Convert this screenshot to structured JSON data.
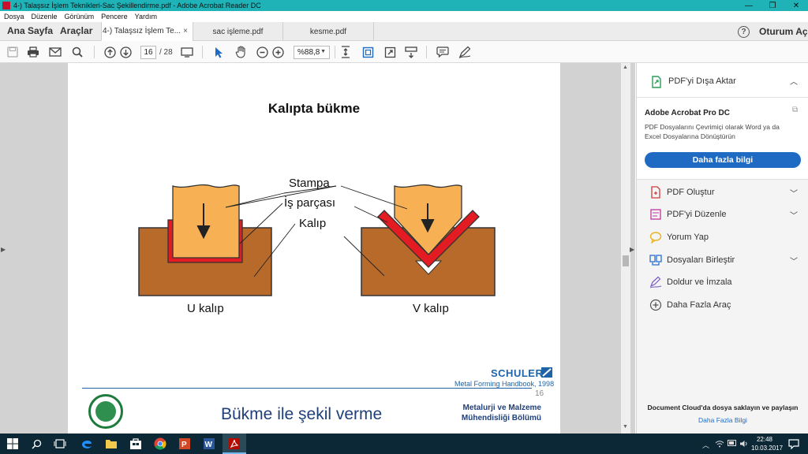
{
  "window": {
    "title": "4-) Talaşsız İşlem Teknikleri-Sac Şekillendirme.pdf - Adobe Acrobat Reader DC",
    "minimize": "—",
    "maximize": "❐",
    "close": "✕"
  },
  "menu": [
    "Dosya",
    "Düzenle",
    "Görünüm",
    "Pencere",
    "Yardım"
  ],
  "tabs": {
    "home": "Ana Sayfa",
    "tools": "Araçlar",
    "documents": [
      {
        "label": "4-) Talaşsız İşlem Te...",
        "active": true,
        "close": "×"
      },
      {
        "label": "sac işleme.pdf",
        "active": false
      },
      {
        "label": "kesme.pdf",
        "active": false
      }
    ],
    "help": "?",
    "signin": "Oturum Aç"
  },
  "toolbar": {
    "current_page": "16",
    "total_pages": "/ 28",
    "zoom": "%88,8",
    "icons": [
      "save-icon",
      "print-icon",
      "email-icon",
      "search-icon",
      "page-up-icon",
      "page-down-icon",
      "page-display-icon",
      "select-cursor-icon",
      "hand-icon",
      "zoom-out-icon",
      "zoom-in-icon",
      "fit-page-icon",
      "crop-icon",
      "fullscreen-icon",
      "scroll-mode-icon",
      "comment-icon",
      "draw-icon"
    ]
  },
  "page": {
    "heading": "Kalıpta bükme",
    "labels": {
      "punch": "Stampa",
      "workpiece": "İş parçası",
      "die": "Kalıp"
    },
    "captions": {
      "u_die": "U kalıp",
      "v_die": "V kalıp"
    },
    "brand": "SCHULER",
    "source": "Metal Forming Handbook, 1998",
    "page_number": "16",
    "footer_title": "Bükme ile şekil verme",
    "footer_dept_line1": "Metalurji ve Malzeme",
    "footer_dept_line2": "Mühendisliği Bölümü",
    "colors": {
      "punch": "#f7b154",
      "die": "#b86a2a",
      "workpiece": "#e31b23"
    }
  },
  "panel": {
    "export": "PDF'yi Dışa Aktar",
    "product": "Adobe Acrobat Pro DC",
    "product_desc": "PDF Dosyalarını Çevrimiçi olarak Word ya da Excel Dosyalarına Dönüştürün",
    "cta": "Daha fazla bilgi",
    "tools": [
      {
        "label": "PDF Oluştur",
        "icon": "create-pdf-icon",
        "expandable": true
      },
      {
        "label": "PDF'yi Düzenle",
        "icon": "edit-pdf-icon",
        "expandable": true
      },
      {
        "label": "Yorum Yap",
        "icon": "comment-icon",
        "expandable": false
      },
      {
        "label": "Dosyaları Birleştir",
        "icon": "combine-files-icon",
        "expandable": true
      },
      {
        "label": "Doldur ve İmzala",
        "icon": "fill-sign-icon",
        "expandable": false
      },
      {
        "label": "Daha Fazla Araç",
        "icon": "more-tools-icon",
        "expandable": false
      }
    ],
    "cloud_text": "Document Cloud'da dosya saklayın ve paylaşın",
    "cloud_link": "Daha Fazla Bilgi"
  },
  "taskbar": {
    "time": "22:48",
    "date": "10.03.2017",
    "apps": [
      "windows-start-icon",
      "search-icon",
      "task-view-icon",
      "edge-icon",
      "file-explorer-icon",
      "store-icon",
      "chrome-icon",
      "powerpoint-icon",
      "word-icon",
      "acrobat-icon"
    ]
  }
}
